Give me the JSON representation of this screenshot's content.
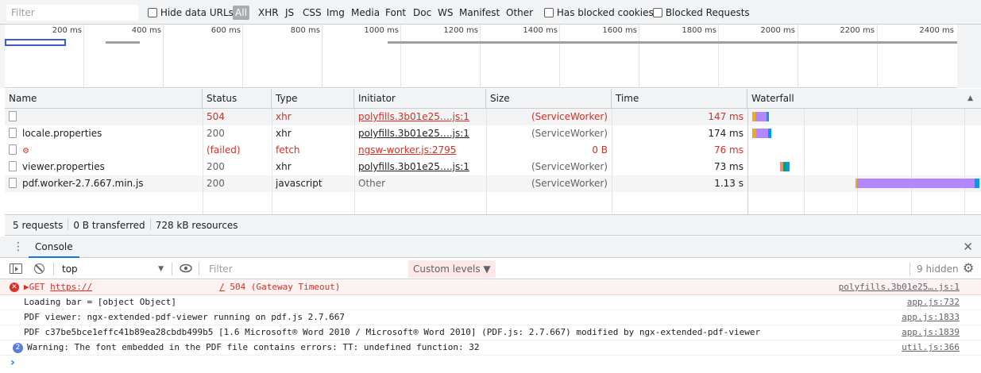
{
  "filterbar": {
    "filter_placeholder": "Filter",
    "hide_data_urls": "Hide data URLs",
    "types": [
      "All",
      "XHR",
      "JS",
      "CSS",
      "Img",
      "Media",
      "Font",
      "Doc",
      "WS",
      "Manifest",
      "Other"
    ],
    "has_blocked_cookies": "Has blocked cookies",
    "blocked_requests": "Blocked Requests"
  },
  "overview": {
    "ticks": [
      "200 ms",
      "400 ms",
      "600 ms",
      "800 ms",
      "1000 ms",
      "1200 ms",
      "1400 ms",
      "1600 ms",
      "1800 ms",
      "2000 ms",
      "2200 ms",
      "2400 ms"
    ]
  },
  "table": {
    "headers": [
      "Name",
      "Status",
      "Type",
      "Initiator",
      "Size",
      "Time",
      "Waterfall"
    ],
    "sort_icon": "triangle-up-icon",
    "rows": [
      {
        "name": "",
        "status": "504",
        "type": "xhr",
        "initiator": "polyfills.3b01e25….js:1",
        "size": "(ServiceWorker)",
        "time": "147 ms",
        "error": true
      },
      {
        "name": "locale.properties",
        "status": "200",
        "type": "xhr",
        "initiator": "polyfills.3b01e25….js:1",
        "size": "(ServiceWorker)",
        "time": "174 ms",
        "error": false
      },
      {
        "name": "",
        "status": "(failed)",
        "type": "fetch",
        "initiator": "ngsw-worker.js:2795",
        "size": "0 B",
        "time": "76 ms",
        "error": true
      },
      {
        "name": "viewer.properties",
        "status": "200",
        "type": "xhr",
        "initiator": "polyfills.3b01e25….js:1",
        "size": "(ServiceWorker)",
        "time": "73 ms",
        "error": false
      },
      {
        "name": "pdf.worker-2.7.667.min.js",
        "status": "200",
        "type": "javascript",
        "initiator": "Other",
        "size": "(ServiceWorker)",
        "time": "1.13 s",
        "error": false
      }
    ]
  },
  "summary": {
    "requests": "5 requests",
    "transferred": "0 B transferred",
    "resources": "728 kB resources"
  },
  "drawer": {
    "tab": "Console",
    "context": "top",
    "filter_placeholder": "Filter",
    "levels": "Custom levels ▼",
    "hidden": "9 hidden"
  },
  "console": {
    "messages": [
      {
        "prefix": "▶GET ",
        "url": "https://",
        "url_end": "/",
        "rest": " 504 (Gateway Timeout)",
        "source": "polyfills.3b01e25….js:1",
        "level": "error"
      },
      {
        "text": "Loading bar = [object Object]",
        "source": "app.js:732",
        "level": "log"
      },
      {
        "text": "PDF viewer: ngx-extended-pdf-viewer running on pdf.js 2.7.667",
        "source": "app.js:1833",
        "level": "log"
      },
      {
        "text": "PDF c37be5bce1effc41b89ea28cbdb499b5 [1.6 Microsoft® Word 2010 / Microsoft® Word 2010] (PDF.js: 2.7.667) modified by ngx-extended-pdf-viewer",
        "source": "app.js:1839",
        "level": "log"
      },
      {
        "text": "Warning: The font embedded in the PDF file contains errors: TT:  undefined function: 32",
        "source": "util.js:366",
        "level": "info",
        "count": "2"
      }
    ],
    "prompt": "›"
  },
  "colors": {
    "error": "#d93025",
    "link_blue": "#1a73e8",
    "waterfall_purple": "#b388ff",
    "waterfall_orange": "#f5a623",
    "waterfall_blue": "#039be5",
    "waterfall_green": "#0ba360"
  }
}
